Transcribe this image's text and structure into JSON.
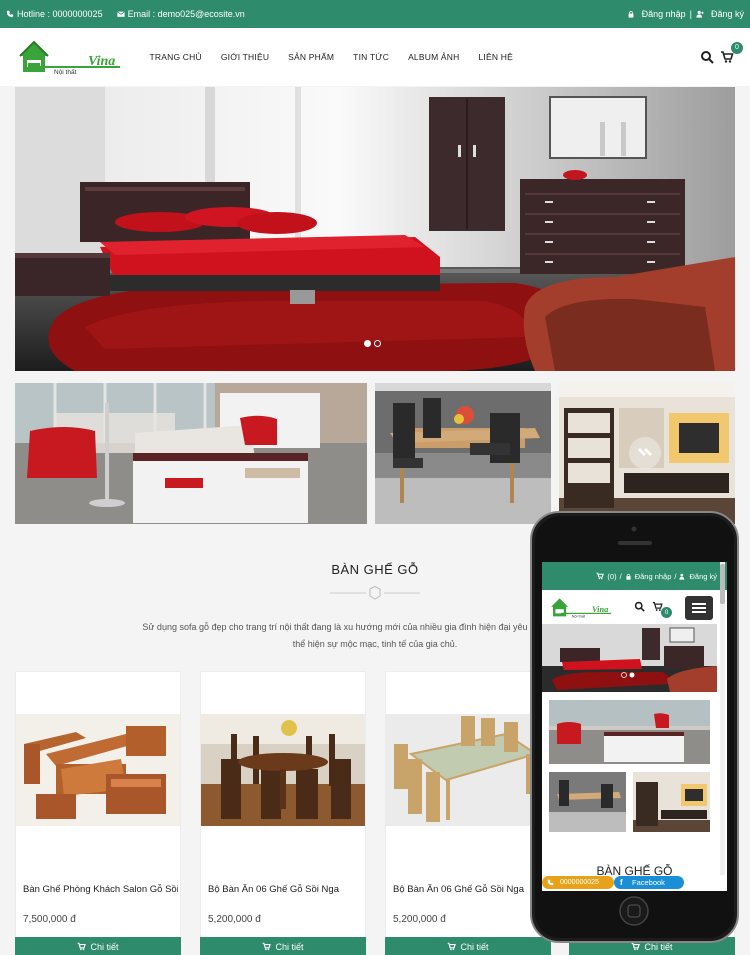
{
  "topbar": {
    "hotline": "Hotline : 0000000025",
    "email": "Email : demo025@ecosite.vn",
    "login": "Đăng nhập",
    "separator": "|",
    "register": "Đăng ký"
  },
  "logo": {
    "line1": "Nội thất",
    "line2": "Vina"
  },
  "nav": [
    "TRANG CHỦ",
    "GIỚI THIỆU",
    "SẢN PHẨM",
    "TIN TỨC",
    "ALBUM ẢNH",
    "LIÊN HỆ"
  ],
  "cart_count": "0",
  "section": {
    "title": "BÀN GHẾ GỖ",
    "desc_line1": "Sử dụng sofa gỗ đẹp cho trang trí nội thất đang là xu hướng mới của nhiều gia đình hiện đại yêu thích sự sang trọng",
    "desc_line2": "thể hiện sự mộc mạc, tinh tế của gia chủ."
  },
  "products": [
    {
      "name": "Bàn Ghế Phòng Khách Salon Gỗ Sồi",
      "price": "7,500,000 đ",
      "button": "Chi tiết"
    },
    {
      "name": "Bộ Bàn Ăn 06 Ghế Gỗ Sồi Nga",
      "price": "5,200,000 đ",
      "button": "Chi tiết"
    },
    {
      "name": "Bộ Bàn Ăn 06 Ghế Gỗ Sồi Nga",
      "price": "5,200,000 đ",
      "button": "Chi tiết"
    },
    {
      "name": "",
      "price": "",
      "button": "Chi tiết"
    }
  ],
  "phone": {
    "cart": "(0)",
    "separator": "/",
    "login": "Đăng nhập",
    "register": "Đăng ký",
    "cart_count": "0",
    "section_title": "BÀN GHẾ GỖ",
    "hotline": "0000000025",
    "facebook": "Facebook"
  },
  "colors": {
    "brand_green": "#2e8b6b",
    "hotline_orange": "#e8a21a",
    "facebook_blue": "#1a8fd6"
  }
}
